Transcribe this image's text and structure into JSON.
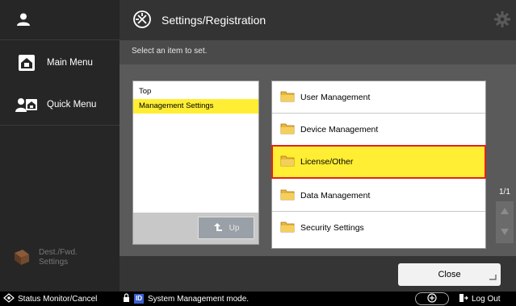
{
  "sidebar": {
    "main_menu": "Main Menu",
    "quick_menu": "Quick Menu",
    "dest_fwd": [
      "Dest./Fwd.",
      "Settings"
    ]
  },
  "header": {
    "title": "Settings/Registration"
  },
  "band": {
    "instruction": "Select an item to set."
  },
  "tree": {
    "items": [
      "Top",
      "Management Settings"
    ],
    "selected_index": 1,
    "up_label": "Up"
  },
  "list": {
    "items": [
      "User Management",
      "Device Management",
      "License/Other",
      "Data Management",
      "Security Settings"
    ],
    "highlighted_index": 2
  },
  "pagination": {
    "page": "1/1"
  },
  "footer": {
    "close_label": "Close"
  },
  "status_bar": {
    "status_monitor": "Status Monitor/Cancel",
    "id_badge": "ID",
    "mode_text": "System Management mode.",
    "logout": "Log Out"
  },
  "colors": {
    "highlight": "#ffee33",
    "highlight_border": "#e0231e",
    "id_badge": "#3a5fd0"
  },
  "icons": {
    "user": "user-icon",
    "home": "home-icon",
    "quick": "quick-menu-icon",
    "settings": "settings-icon",
    "gear": "gear-icon",
    "folder": "folder-icon",
    "up_arrow": "up-arrow-icon",
    "logout": "logout-icon"
  }
}
